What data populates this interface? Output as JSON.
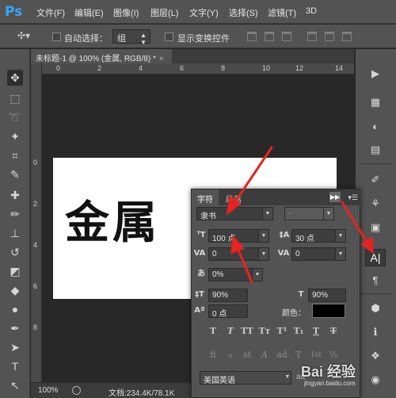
{
  "app": {
    "logo": "Ps"
  },
  "menu": [
    "文件(F)",
    "编辑(E)",
    "图像(I)",
    "图层(L)",
    "文字(Y)",
    "选择(S)",
    "滤镜(T)",
    "3D"
  ],
  "options": {
    "auto_select_label": "自动选择：",
    "auto_select_value": "组",
    "show_transform_label": "显示变换控件"
  },
  "document": {
    "tab_title": "未标题-1 @ 100% (金属, RGB/8) *",
    "close": "×",
    "text": "金属",
    "zoom": "100%",
    "info": "文档:234.4K/78.1K",
    "ruler_h": [
      "0",
      "2",
      "4",
      "6",
      "8",
      "10",
      "12",
      "14"
    ],
    "ruler_v": [
      "0",
      "2",
      "4",
      "6",
      "8"
    ]
  },
  "character_panel": {
    "tabs": [
      "字符",
      "段落"
    ],
    "font_family": "隶书",
    "font_style": "-",
    "font_size": "100 点",
    "leading": "30 点",
    "kerning": "0",
    "tracking": "0",
    "tsume": "0%",
    "vertical_scale": "90%",
    "horizontal_scale": "90%",
    "baseline_shift": "0 点",
    "color_label": "颜色：",
    "color": "#000000",
    "language": "美国英语",
    "aa_label": "aa",
    "style_buttons": [
      "T",
      "T",
      "TT",
      "Tт",
      "T¹",
      "T₁",
      "T",
      "T"
    ],
    "opentype_buttons": [
      "fi",
      "ℴ",
      "st",
      "A",
      "ad",
      "T",
      "1st",
      "½"
    ]
  },
  "watermark": {
    "text": "Bai 经验",
    "sub": "jingyan.baidu.com"
  }
}
